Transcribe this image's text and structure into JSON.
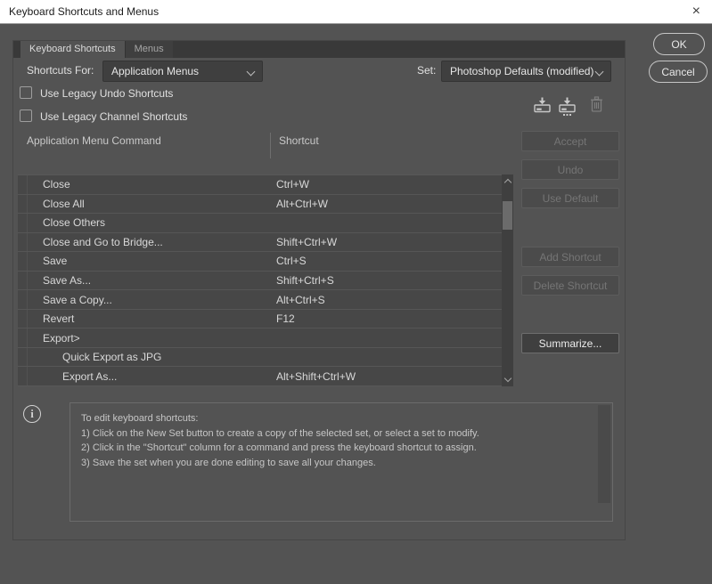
{
  "window": {
    "title": "Keyboard Shortcuts and Menus",
    "close_glyph": "×"
  },
  "tabs": {
    "keyboard_shortcuts": "Keyboard Shortcuts",
    "menus": "Menus"
  },
  "controls": {
    "shortcuts_for_label": "Shortcuts For:",
    "shortcuts_for_value": "Application Menus",
    "set_label": "Set:",
    "set_value": "Photoshop Defaults (modified)",
    "legacy_undo_label": "Use Legacy Undo Shortcuts",
    "legacy_undo_checked": false,
    "legacy_channel_label": "Use Legacy Channel Shortcuts",
    "legacy_channel_checked": false
  },
  "icons": {
    "save_set": "save-set-icon",
    "new_set": "new-set-icon",
    "delete_set": "delete-set-icon",
    "info": "i"
  },
  "table": {
    "header_command": "Application Menu Command",
    "header_shortcut": "Shortcut",
    "rows": [
      {
        "command": "Close",
        "shortcut": "Ctrl+W",
        "indent": 1
      },
      {
        "command": "Close All",
        "shortcut": "Alt+Ctrl+W",
        "indent": 1
      },
      {
        "command": "Close Others",
        "shortcut": "",
        "indent": 1
      },
      {
        "command": "Close and Go to Bridge...",
        "shortcut": "Shift+Ctrl+W",
        "indent": 1
      },
      {
        "command": "Save",
        "shortcut": "Ctrl+S",
        "indent": 1
      },
      {
        "command": "Save As...",
        "shortcut": "Shift+Ctrl+S",
        "indent": 1
      },
      {
        "command": "Save a Copy...",
        "shortcut": "Alt+Ctrl+S",
        "indent": 1
      },
      {
        "command": "Revert",
        "shortcut": "F12",
        "indent": 1
      },
      {
        "command": "Export>",
        "shortcut": "",
        "indent": 1
      },
      {
        "command": "Quick Export as JPG",
        "shortcut": "",
        "indent": 2
      },
      {
        "command": "Export As...",
        "shortcut": "Alt+Shift+Ctrl+W",
        "indent": 2
      }
    ]
  },
  "side_buttons": {
    "accept": "Accept",
    "undo": "Undo",
    "use_default": "Use Default",
    "add_shortcut": "Add Shortcut",
    "delete_shortcut": "Delete Shortcut",
    "summarize": "Summarize..."
  },
  "info": {
    "glyph": "i",
    "lines": [
      "To edit keyboard shortcuts:",
      "1) Click on the New Set button to create a copy of the selected set, or select a set to modify.",
      "2) Click in the \"Shortcut\" column for a command and press the keyboard shortcut to assign.",
      "3) Save the set when you are done editing to save all your changes."
    ]
  },
  "dialog_buttons": {
    "ok": "OK",
    "cancel": "Cancel"
  },
  "colors": {
    "titlebar_bg": "#ffffff",
    "dialog_bg": "#535353",
    "tab_strip": "#393939",
    "row_bg": "#474747",
    "control_bg": "#3f3f3f",
    "text": "#d8d8d8",
    "disabled_text": "#757575"
  }
}
